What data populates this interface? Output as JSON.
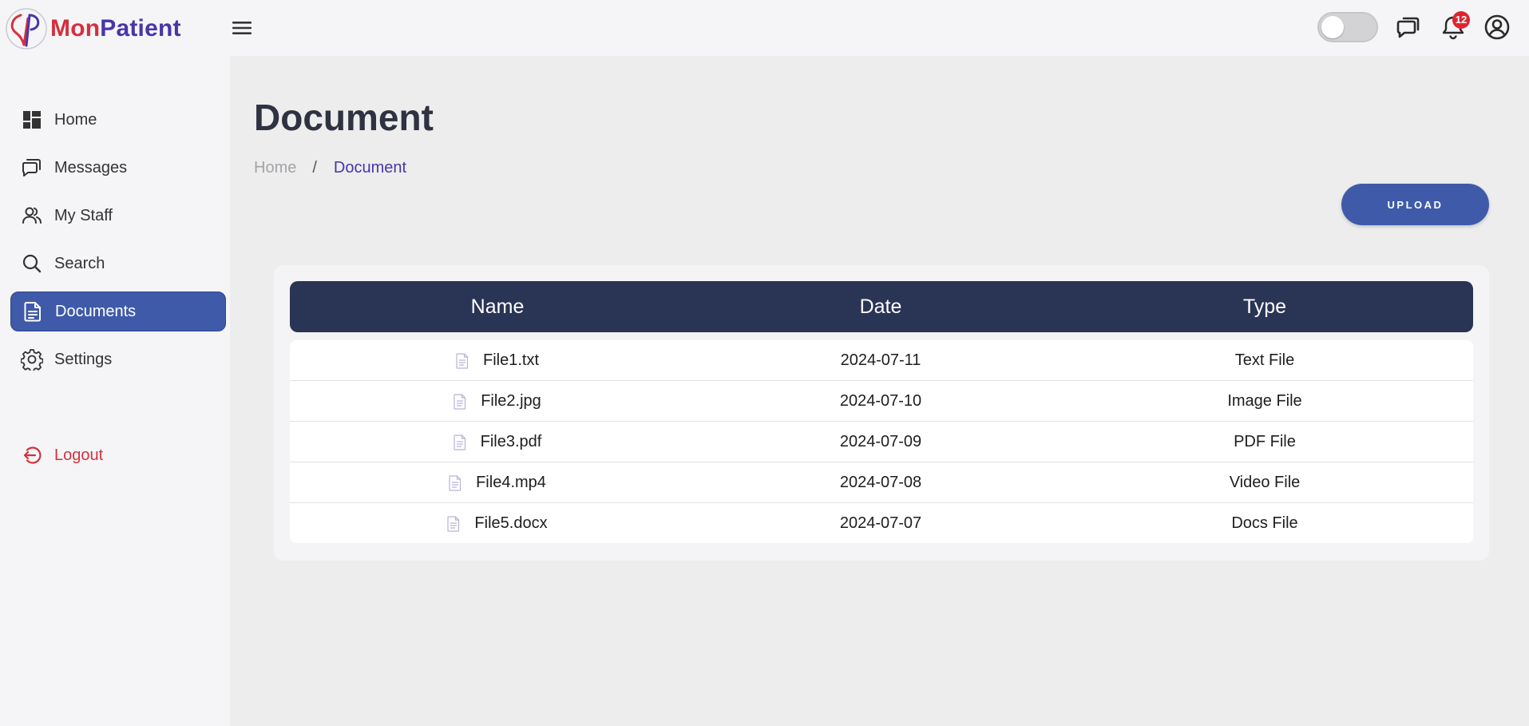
{
  "brand": {
    "name_part1": "Mon",
    "name_part2": "Patient"
  },
  "header": {
    "menu_icon": "hamburger-menu-icon",
    "theme_toggle": {
      "state": "off"
    },
    "icons": [
      "chat-icon",
      "bell-icon",
      "account-circle-icon"
    ],
    "notification_count": "12"
  },
  "sidebar": {
    "items": [
      {
        "label": "Home",
        "icon": "dashboard-icon"
      },
      {
        "label": "Messages",
        "icon": "chat-icon"
      },
      {
        "label": "My Staff",
        "icon": "users-icon"
      },
      {
        "label": "Search",
        "icon": "search-icon"
      },
      {
        "label": "Documents",
        "icon": "document-icon",
        "active": true
      },
      {
        "label": "Settings",
        "icon": "gear-icon"
      }
    ],
    "logout_label": "Logout"
  },
  "page": {
    "title": "Document",
    "breadcrumb": {
      "home": "Home",
      "separator": "/",
      "current": "Document"
    },
    "upload_label": "UPLOAD"
  },
  "table": {
    "headers": {
      "name": "Name",
      "date": "Date",
      "type": "Type"
    },
    "rows": [
      {
        "name": "File1.txt",
        "date": "2024-07-11",
        "type": "Text File"
      },
      {
        "name": "File2.jpg",
        "date": "2024-07-10",
        "type": "Image File"
      },
      {
        "name": "File3.pdf",
        "date": "2024-07-09",
        "type": "PDF File"
      },
      {
        "name": "File4.mp4",
        "date": "2024-07-08",
        "type": "Video File"
      },
      {
        "name": "File5.docx",
        "date": "2024-07-07",
        "type": "Docs File"
      }
    ]
  },
  "colors": {
    "primary": "#3f5aa8",
    "table_header": "#2a3454",
    "brand_red": "#d5303e",
    "brand_purple": "#4a35a8",
    "badge": "#e0232e"
  }
}
